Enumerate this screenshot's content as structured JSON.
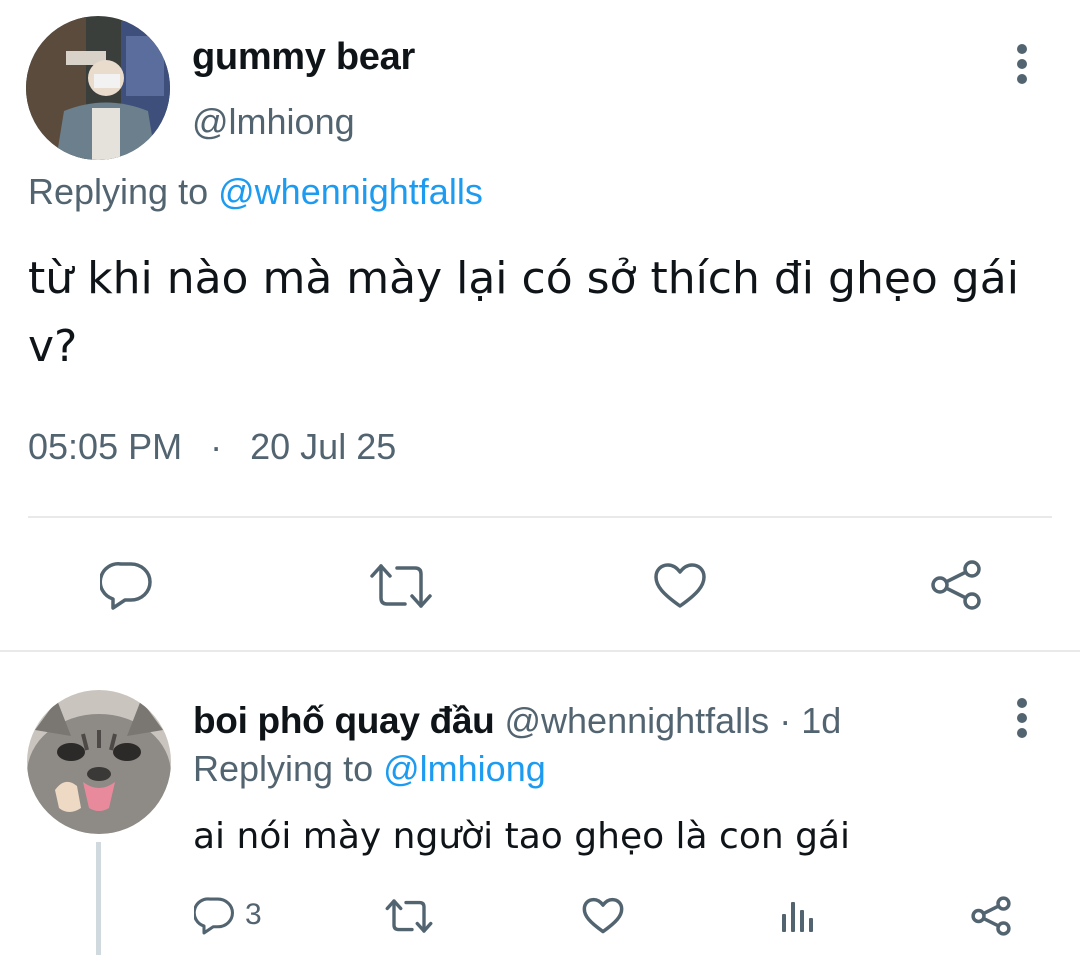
{
  "main_tweet": {
    "display_name": "gummy bear",
    "handle": "@lmhiong",
    "replying_prefix": "Replying to",
    "replying_to": "@whennightfalls",
    "text": "từ khi nào mà mày lại có sở thích đi ghẹo gái v?",
    "time": "05:05 PM",
    "separator": "·",
    "date": "20 Jul 25",
    "icons": [
      "reply-icon",
      "retweet-icon",
      "like-icon",
      "share-icon",
      "more-options-icon"
    ]
  },
  "reply_tweet": {
    "display_name": "boi phố quay đầu",
    "handle": "@whennightfalls",
    "separator": "·",
    "age": "1d",
    "replying_prefix": "Replying to",
    "replying_to": "@lmhiong",
    "text": "ai nói mày người tao ghẹo là con gái",
    "reply_count": "3",
    "icons": [
      "reply-icon",
      "retweet-icon",
      "like-icon",
      "analytics-icon",
      "share-icon",
      "more-options-icon"
    ]
  },
  "colors": {
    "text": "#0f1419",
    "secondary": "#536471",
    "link": "#1d9bf0",
    "divider": "#e7e9ea"
  }
}
